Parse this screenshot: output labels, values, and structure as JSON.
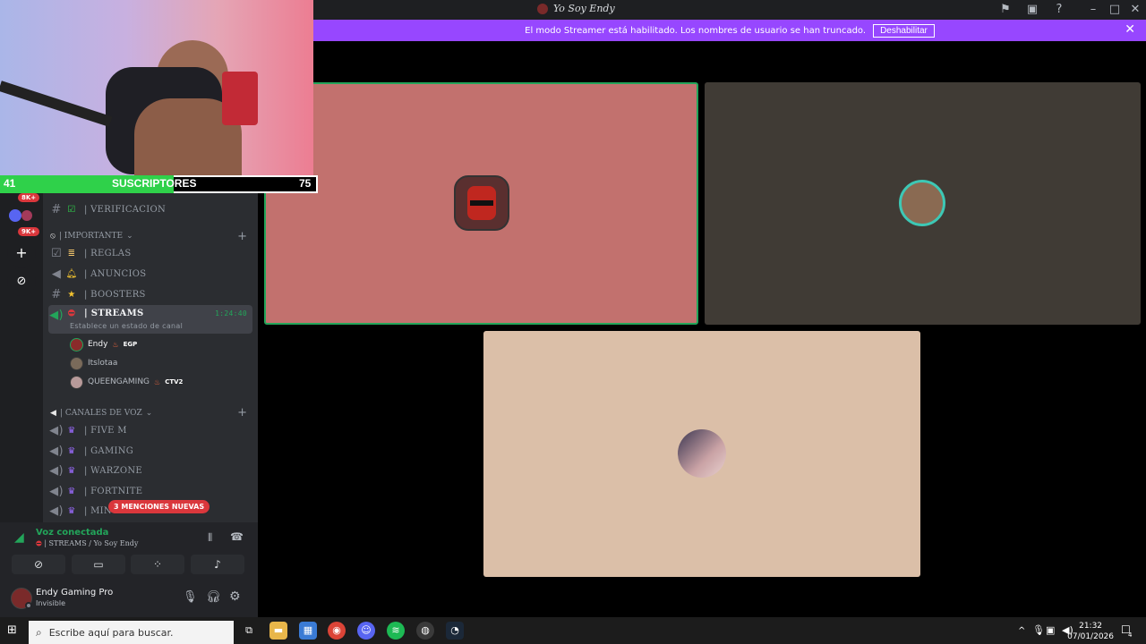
{
  "window": {
    "title": "Yo Soy Endy"
  },
  "banner": {
    "message": "El modo Streamer está habilitado. Los nombres de usuario se han truncado.",
    "button": "Deshabilitar"
  },
  "overlay": {
    "subscribers_left": "41",
    "subscribers_label": "SUSCRIPTORES",
    "subscribers_right": "75",
    "subscribers_progress": 0.547
  },
  "rail": {
    "badges": [
      "8K+",
      "9K+"
    ]
  },
  "channels": {
    "verificacion": "| VERIFICACION",
    "cat_importante": "| IMPORTANTE",
    "reglas": "| REGLAS",
    "anuncios": "| ANUNCIOS",
    "boosters": "| BOOSTERS",
    "streams": "| STREAMS",
    "streams_timer": "1:24:40",
    "streams_status": "Establece un estado de canal",
    "users": [
      {
        "name": "Endy",
        "tag": "EGP"
      },
      {
        "name": "Itslotaa",
        "tag": ""
      },
      {
        "name": "QUEENGAMING",
        "tag": "CTV2"
      }
    ],
    "cat_voz": "| CANALES DE VOZ",
    "fivem": "| FIVE M",
    "gaming": "|  GAMING",
    "warzone": "| WARZONE",
    "fortnite": "| FORTNITE",
    "minecraft": "| MIN",
    "mentions": "3 MENCIONES NUEVAS"
  },
  "voice": {
    "status": "Voz conectada",
    "channel": "| STREAMS / Yo Soy Endy"
  },
  "user": {
    "name": "Endy Gaming Pro",
    "status": "Invisible"
  },
  "taskbar": {
    "search_placeholder": "Escribe aquí para buscar.",
    "time": "21:32",
    "date": "07/01/2026",
    "notifications": "4"
  },
  "colors": {
    "streamer_banner": "#9747ff",
    "tile_1": "#c2716e",
    "tile_2": "#403b35",
    "tile_3": "#dbbfa8",
    "speaking": "#23a55a",
    "subs_bar": "#2fd14a"
  }
}
